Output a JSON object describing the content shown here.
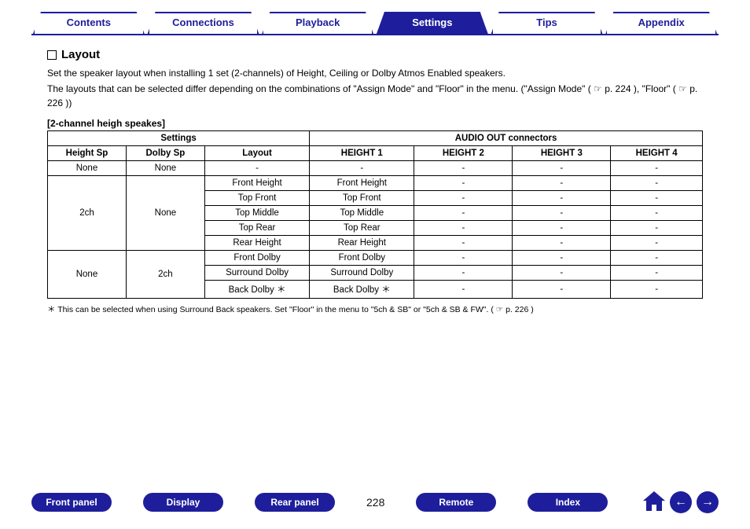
{
  "tabs": [
    {
      "label": "Contents",
      "active": false
    },
    {
      "label": "Connections",
      "active": false
    },
    {
      "label": "Playback",
      "active": false
    },
    {
      "label": "Settings",
      "active": true
    },
    {
      "label": "Tips",
      "active": false
    },
    {
      "label": "Appendix",
      "active": false
    }
  ],
  "section": {
    "title": "Layout",
    "para1": "Set the speaker layout when installing 1 set (2-channels) of Height, Ceiling or Dolby Atmos Enabled speakers.",
    "para2_pre": "The layouts that can be selected differ depending on the combinations of \"Assign Mode\" and \"Floor\" in the menu. (\"Assign Mode\" (",
    "para2_ref1": "p. 224",
    "para2_mid": "), \"Floor\" (",
    "para2_ref2": "p. 226",
    "para2_post": "))",
    "sub": "[2-channel heigh speakes]"
  },
  "table": {
    "group_headers": [
      "Settings",
      "AUDIO OUT connectors"
    ],
    "sub_headers": [
      "Height Sp",
      "Dolby Sp",
      "Layout",
      "HEIGHT 1",
      "HEIGHT 2",
      "HEIGHT 3",
      "HEIGHT 4"
    ],
    "rows": [
      {
        "hsp": "None",
        "dsp": "None",
        "layout": "-",
        "h1": "-",
        "h2": "-",
        "h3": "-",
        "h4": "-",
        "span_h": 1,
        "span_d": 1
      },
      {
        "hsp": "2ch",
        "dsp": "None",
        "layout": "Front Height",
        "h1": "Front Height",
        "h2": "-",
        "h3": "-",
        "h4": "-",
        "span_h": 5,
        "span_d": 5
      },
      {
        "layout": "Top Front",
        "h1": "Top Front",
        "h2": "-",
        "h3": "-",
        "h4": "-"
      },
      {
        "layout": "Top Middle",
        "h1": "Top Middle",
        "h2": "-",
        "h3": "-",
        "h4": "-"
      },
      {
        "layout": "Top Rear",
        "h1": "Top Rear",
        "h2": "-",
        "h3": "-",
        "h4": "-"
      },
      {
        "layout": "Rear Height",
        "h1": "Rear Height",
        "h2": "-",
        "h3": "-",
        "h4": "-"
      },
      {
        "hsp": "None",
        "dsp": "2ch",
        "layout": "Front Dolby",
        "h1": "Front Dolby",
        "h2": "-",
        "h3": "-",
        "h4": "-",
        "span_h": 3,
        "span_d": 3
      },
      {
        "layout": "Surround Dolby",
        "h1": "Surround Dolby",
        "h2": "-",
        "h3": "-",
        "h4": "-"
      },
      {
        "layout": "Back Dolby ＊",
        "h1": "Back Dolby ＊",
        "h2": "-",
        "h3": "-",
        "h4": "-"
      }
    ]
  },
  "footnote_pre": "＊ This can be selected when using Surround Back speakers. Set \"Floor\" in the menu to \"5ch & SB\" or \"5ch & SB & FW\".  (",
  "footnote_ref": "p. 226",
  "footnote_post": ")",
  "bottom": {
    "pills": [
      "Front panel",
      "Display",
      "Rear panel"
    ],
    "page": "228",
    "pills2": [
      "Remote",
      "Index"
    ]
  }
}
